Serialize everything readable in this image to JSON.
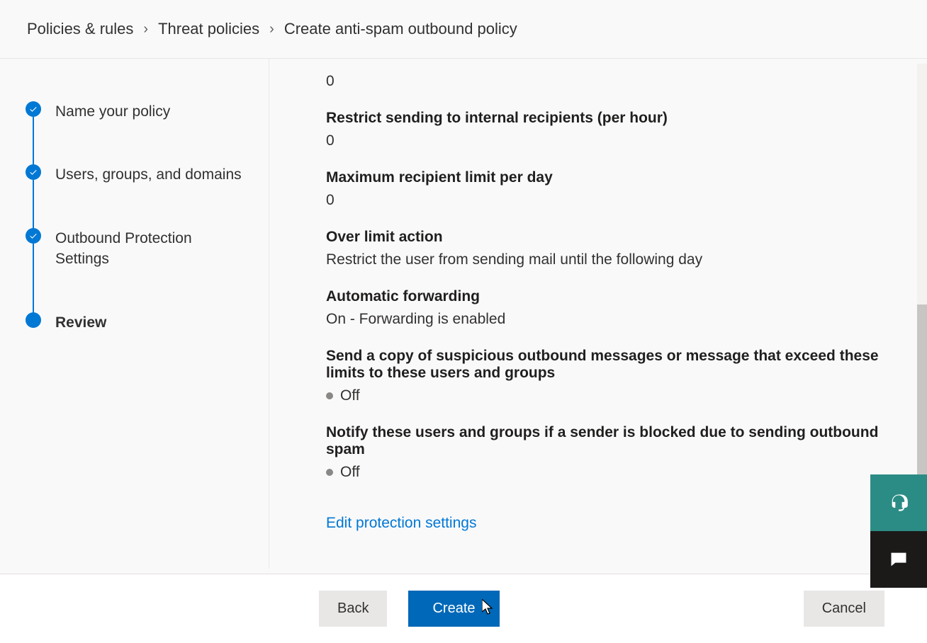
{
  "breadcrumb": {
    "items": [
      "Policies & rules",
      "Threat policies",
      "Create anti-spam outbound policy"
    ]
  },
  "wizard": {
    "steps": [
      {
        "label": "Name your policy",
        "state": "done"
      },
      {
        "label": "Users, groups, and domains",
        "state": "done"
      },
      {
        "label": "Outbound Protection Settings",
        "state": "done"
      },
      {
        "label": "Review",
        "state": "current"
      }
    ]
  },
  "review": {
    "top_value": "0",
    "restrict_internal": {
      "label": "Restrict sending to internal recipients (per hour)",
      "value": "0"
    },
    "max_recipient": {
      "label": "Maximum recipient limit per day",
      "value": "0"
    },
    "over_limit": {
      "label": "Over limit action",
      "value": "Restrict the user from sending mail until the following day"
    },
    "auto_forwarding": {
      "label": "Automatic forwarding",
      "value": "On - Forwarding is enabled"
    },
    "send_copy": {
      "label": "Send a copy of suspicious outbound messages or message that exceed these limits to these users and groups",
      "status": "Off"
    },
    "notify_blocked": {
      "label": "Notify these users and groups if a sender is blocked due to sending outbound spam",
      "status": "Off"
    },
    "edit_link": "Edit protection settings"
  },
  "footer": {
    "back": "Back",
    "create": "Create",
    "cancel": "Cancel"
  }
}
